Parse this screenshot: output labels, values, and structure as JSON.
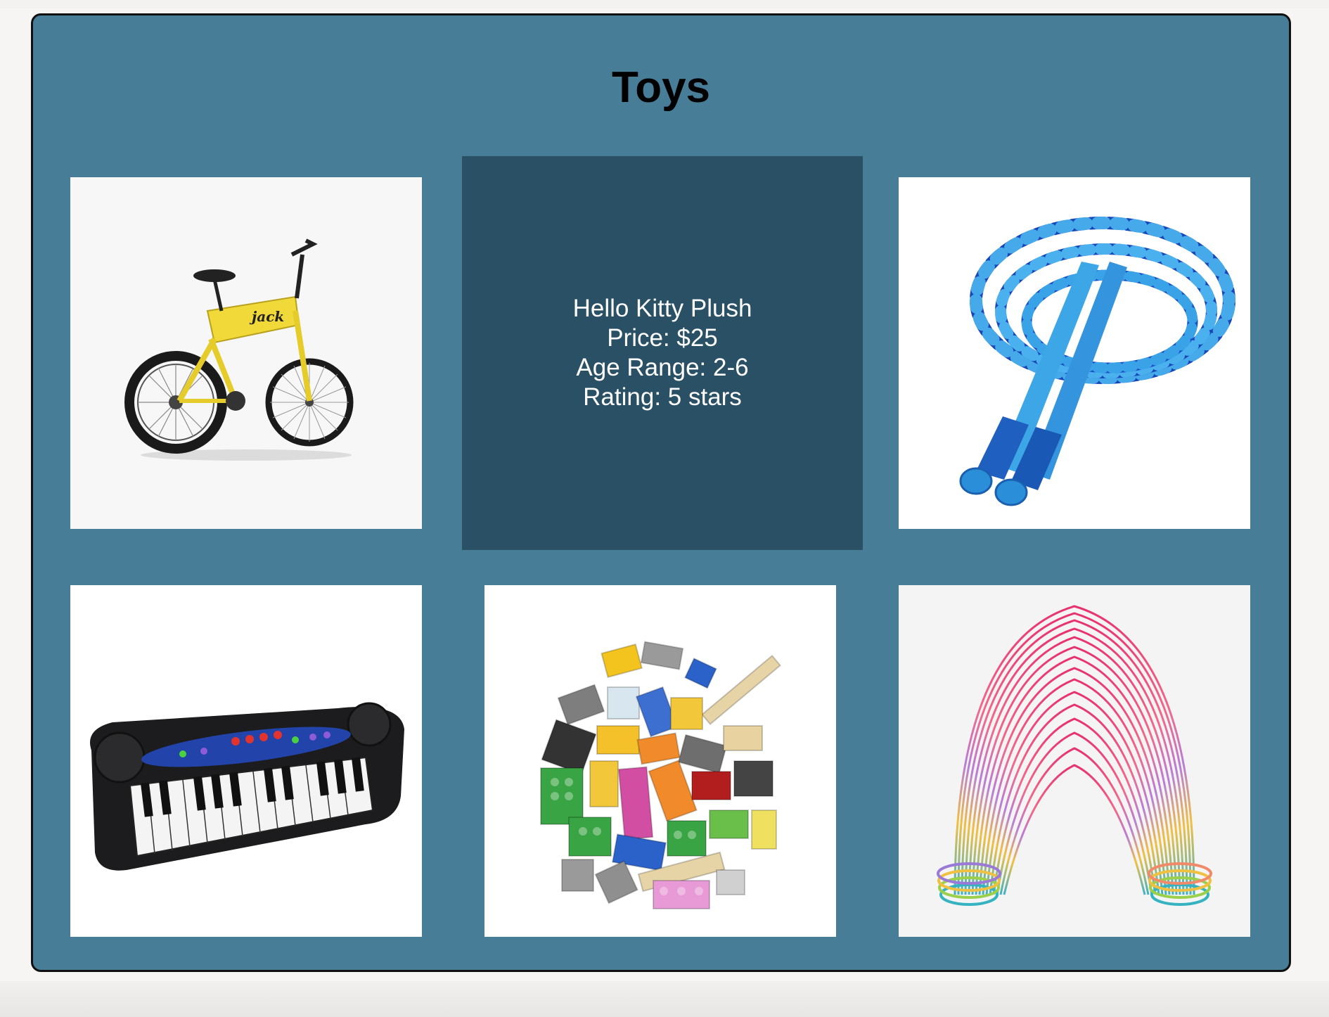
{
  "page": {
    "title": "Toys"
  },
  "featured": {
    "name": "Hello Kitty Plush",
    "price": "Price: $25",
    "age_range": "Age Range: 2-6",
    "rating": "Rating: 5 stars"
  },
  "products": [
    {
      "icon": "bicycle-image",
      "brand_text": "jack"
    },
    {
      "icon": "jump-rope-image"
    },
    {
      "icon": "keyboard-piano-image"
    },
    {
      "icon": "building-blocks-image"
    },
    {
      "icon": "slinky-image"
    }
  ],
  "colors": {
    "panel": "#477d97",
    "info_card": "#295064",
    "background": "#f6f5f3"
  }
}
